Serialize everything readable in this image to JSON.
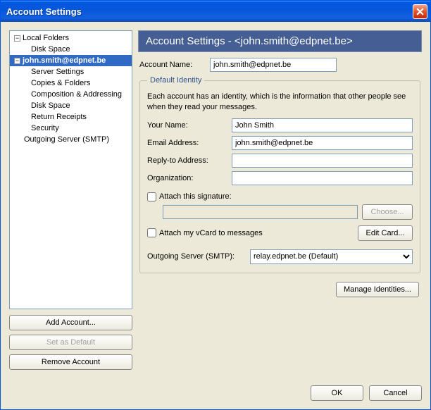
{
  "window": {
    "title": "Account Settings"
  },
  "tree": {
    "local_folders": "Local Folders",
    "local_disk_space": "Disk Space",
    "account": "john.smith@edpnet.be",
    "server_settings": "Server Settings",
    "copies_folders": "Copies & Folders",
    "composition": "Composition & Addressing",
    "acct_disk_space": "Disk Space",
    "return_receipts": "Return Receipts",
    "security": "Security",
    "outgoing": "Outgoing Server (SMTP)"
  },
  "left_buttons": {
    "add": "Add Account...",
    "set_default": "Set as Default",
    "remove": "Remove Account"
  },
  "header": {
    "title_prefix": "Account Settings - ",
    "email": "<john.smith@edpnet.be>"
  },
  "account_name": {
    "label": "Account Name:",
    "value": "john.smith@edpnet.be"
  },
  "fieldset": {
    "legend": "Default Identity",
    "desc": "Each account has an identity, which is the information that other people see when they read your messages.",
    "your_name_label": "Your Name:",
    "your_name_value": "John Smith",
    "email_label": "Email Address:",
    "email_value": "john.smith@edpnet.be",
    "reply_label": "Reply-to Address:",
    "reply_value": "",
    "org_label": "Organization:",
    "org_value": "",
    "attach_sig": "Attach this signature:",
    "choose": "Choose...",
    "attach_vcard": "Attach my vCard to messages",
    "edit_card": "Edit Card...",
    "smtp_label": "Outgoing Server (SMTP):",
    "smtp_value": "relay.edpnet.be (Default)"
  },
  "manage_identities": "Manage Identities...",
  "footer": {
    "ok": "OK",
    "cancel": "Cancel"
  }
}
